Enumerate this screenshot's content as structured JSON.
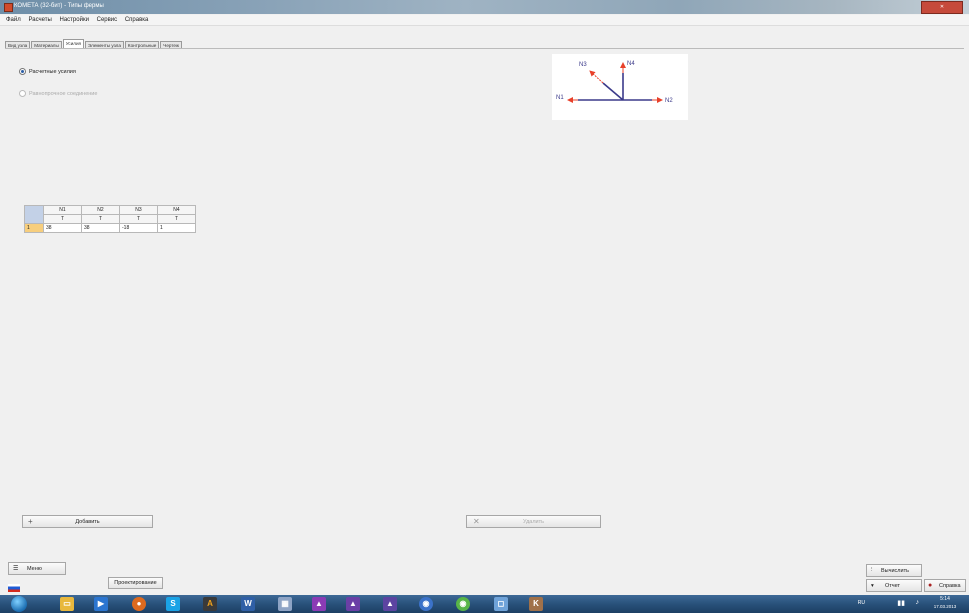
{
  "window": {
    "title": "КОМЕТА (32-бит) - Типы фермы"
  },
  "menu": [
    "Файл",
    "Расчеты",
    "Настройки",
    "Сервис",
    "Справка"
  ],
  "tabs": [
    {
      "label": "Вид узла",
      "active": false
    },
    {
      "label": "Материалы",
      "active": false
    },
    {
      "label": "Усилия",
      "active": true
    },
    {
      "label": "Элементы узла",
      "active": false
    },
    {
      "label": "Контрольные",
      "active": false
    },
    {
      "label": "Чертеж",
      "active": false
    }
  ],
  "options": {
    "option1": {
      "label": "Расчетные усилия",
      "checked": true,
      "enabled": true
    },
    "option2": {
      "label": "Равнопрочное соединение",
      "checked": false,
      "enabled": false
    }
  },
  "diagram": {
    "labels": {
      "n1": "N1",
      "n2": "N2",
      "n3": "N3",
      "n4": "N4"
    },
    "colors": {
      "arrow": "#e8402a",
      "member": "#3b3a8a"
    }
  },
  "grid": {
    "columns": [
      "N1",
      "N2",
      "N3",
      "N4"
    ],
    "units": [
      "T",
      "T",
      "T",
      "T"
    ],
    "rows": [
      {
        "num": "1",
        "values": [
          "38",
          "38",
          "-18",
          "1"
        ]
      }
    ]
  },
  "buttons": {
    "add": "Добавить",
    "delete": "Удалить",
    "menu": "Меню",
    "preview": "Проектирование",
    "calculate": "Вычислить",
    "report": "Отчет",
    "help": "Справка"
  },
  "taskbar": {
    "lang": "RU",
    "time": "5:14",
    "date": "17.03.2013",
    "icons": [
      "ie-icon",
      "explorer-icon",
      "media-player-icon",
      "firefox-icon",
      "skype-icon",
      "app-icon",
      "word-icon",
      "save-icon",
      "calculator-icon",
      "chart-icon",
      "chart-icon",
      "chart-icon",
      "chrome-icon",
      "green-app-icon",
      "square-icon",
      "kometa-icon"
    ]
  }
}
